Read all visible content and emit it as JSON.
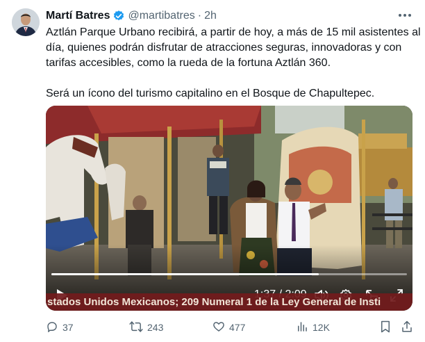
{
  "author": {
    "name": "Martí Batres",
    "handle": "@martibatres",
    "separator": "·",
    "time": "2h",
    "verified": true,
    "verified_color": "#1d9bf0"
  },
  "tweet": {
    "lines": [
      "Aztlán Parque Urbano recibirá, a partir de hoy, a más de 15 mil asistentes al",
      "día, quienes podrán disfrutar de atracciones seguras, innovadoras y con",
      "tarifas accesibles, como la rueda de la fortuna Aztlán 360.",
      "Será un ícono del turismo capitalino en el Bosque de Chapultepec."
    ]
  },
  "video": {
    "subtitle": "stados Unidos Mexicanos; 209 Numeral 1 de la Ley General de Insti",
    "current_time": "1:37",
    "duration": "2:09",
    "time_separator": "/",
    "progress_fraction": 0.752,
    "icons": [
      "play-icon",
      "volume-icon",
      "settings-icon",
      "pip-icon",
      "fullscreen-icon"
    ]
  },
  "actions": {
    "replies": "37",
    "reposts": "243",
    "likes": "477",
    "views": "12K"
  },
  "colors": {
    "text_primary": "#0f1419",
    "text_secondary": "#536471",
    "subtitle_bar": "#6e1416"
  }
}
